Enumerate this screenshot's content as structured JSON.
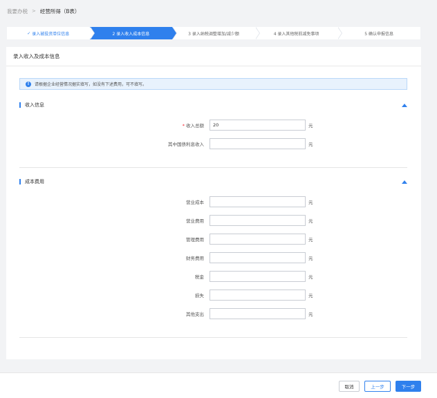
{
  "breadcrumb": {
    "home": "我要办税",
    "separator": ">",
    "current": "经营所得（B表）"
  },
  "steps": [
    {
      "label": "录入被投资单位信息",
      "state": "done"
    },
    {
      "label": "2 录入收入成本信息",
      "state": "active"
    },
    {
      "label": "3 录入纳税调整增加/减少额",
      "state": "todo"
    },
    {
      "label": "4 录入其他税前减免事项",
      "state": "todo"
    },
    {
      "label": "5 确认申报信息",
      "state": "todo"
    }
  ],
  "card": {
    "title": "录入收入及成本信息",
    "notice": "请根据企业经营情况据实填写，如没有下述费用，可不填写。"
  },
  "income": {
    "heading": "收入信息",
    "fields": [
      {
        "label": "收入总额",
        "required": true,
        "value": "20",
        "unit": "元"
      },
      {
        "label": "其中国债利息收入",
        "required": false,
        "value": "",
        "unit": "元"
      }
    ]
  },
  "costs": {
    "heading": "成本费用",
    "fields": [
      {
        "label": "营业成本",
        "value": "",
        "unit": "元"
      },
      {
        "label": "营业费用",
        "value": "",
        "unit": "元"
      },
      {
        "label": "管理费用",
        "value": "",
        "unit": "元"
      },
      {
        "label": "财务费用",
        "value": "",
        "unit": "元"
      },
      {
        "label": "税金",
        "value": "",
        "unit": "元"
      },
      {
        "label": "损失",
        "value": "",
        "unit": "元"
      },
      {
        "label": "其他支出",
        "value": "",
        "unit": "元"
      }
    ]
  },
  "footer": {
    "cancel": "取消",
    "prev": "上一步",
    "next": "下一步"
  },
  "colors": {
    "accent": "#2f80ed",
    "required": "#f5222d"
  }
}
